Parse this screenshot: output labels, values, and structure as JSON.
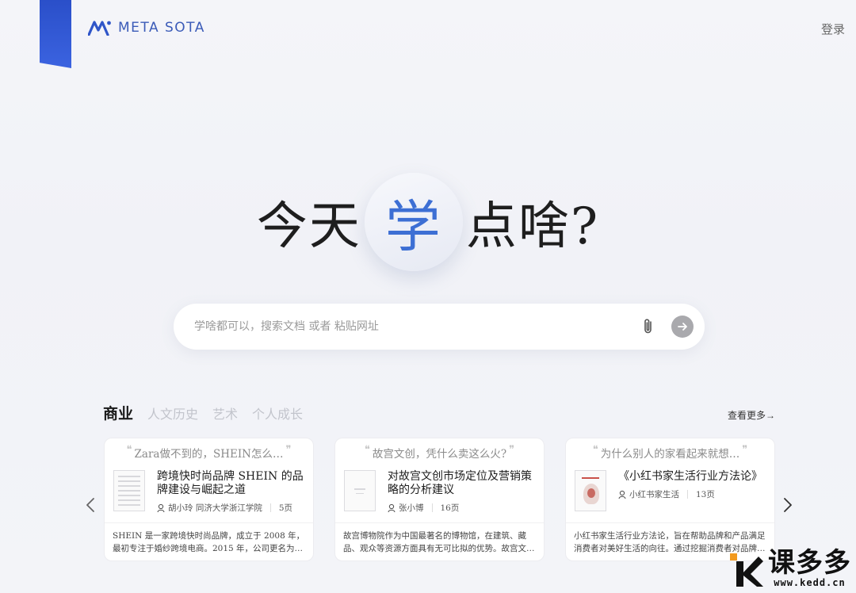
{
  "header": {
    "logo_text": "META SOTA",
    "login_label": "登录",
    "brand_color": "#2a4fc9"
  },
  "hero": {
    "part1": "今天",
    "highlight": "学",
    "part2": "点啥?",
    "highlight_color": "#3d6fd4"
  },
  "search": {
    "placeholder": "学啥都可以，搜索文档 或者 粘贴网址",
    "value": "",
    "attach_icon": "paperclip-icon",
    "send_icon": "arrow-right-icon"
  },
  "categories": {
    "tabs": [
      {
        "label": "商业",
        "active": true
      },
      {
        "label": "人文历史",
        "active": false
      },
      {
        "label": "艺术",
        "active": false
      },
      {
        "label": "个人成长",
        "active": false
      }
    ],
    "more_label": "查看更多→"
  },
  "cards": [
    {
      "quote": "Zara做不到的，SHEIN怎么…",
      "title": "跨境快时尚品牌 SHEIN 的品牌建设与崛起之道",
      "author": "胡小玲 同济大学浙江学院",
      "pages": "5页",
      "desc": "SHEIN 是一家跨境快时尚品牌，成立于 2008 年，最初专注于婚纱跨境电商。2015 年，公司更名为…"
    },
    {
      "quote": "故宫文创，凭什么卖这么火?",
      "title": "对故宫文创市场定位及营销策略的分析建议",
      "author": "张小博",
      "pages": "16页",
      "desc": "故宫博物院作为中国最著名的博物馆，在建筑、藏品、观众等资源方面具有无可比拟的优势。故宫文…"
    },
    {
      "quote": "为什么别人的家看起来就想…",
      "title": "《小红书家生活行业方法论》",
      "author": "小红书家生活",
      "pages": "13页",
      "desc": "小红书家生活行业方法论，旨在帮助品牌和产品满足消费者对美好生活的向往。通过挖掘消费者对品牌…"
    }
  ],
  "watermark": {
    "name": "课多多",
    "url": "www.kedd.cn"
  }
}
